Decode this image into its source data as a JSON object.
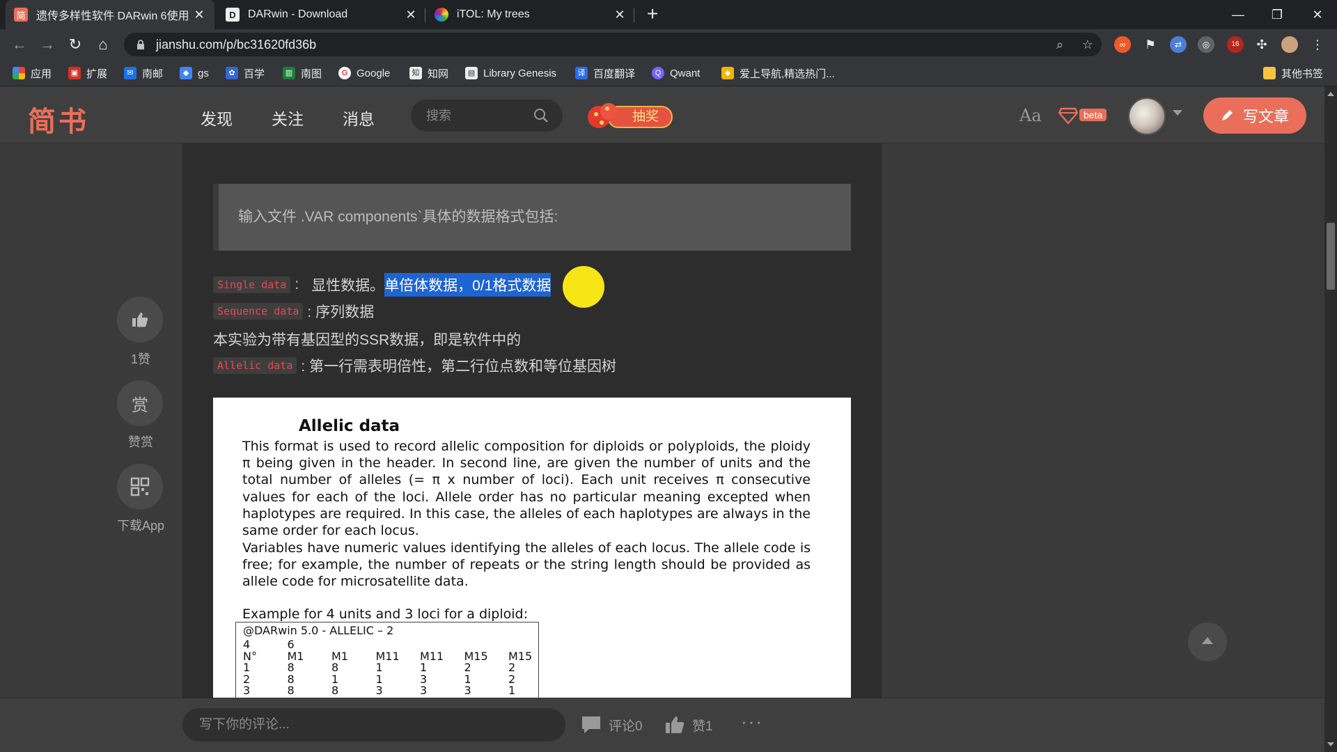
{
  "browser": {
    "tabs": [
      {
        "title": "遗传多样性软件 DARwin 6使用",
        "favicon_text": "简",
        "favicon_color": "#ea6f5a",
        "active": true
      },
      {
        "title": "DARwin - Download",
        "favicon_text": "D",
        "favicon_color": "#3d3d3d",
        "active": false
      },
      {
        "title": "iTOL: My trees",
        "favicon_text": "",
        "favicon_color": "#3a55c8",
        "active": false
      }
    ],
    "url": "jianshu.com/p/bc31620fd36b",
    "profile_badge": "16",
    "bookmarks": [
      {
        "label": "应用",
        "color": "#4285f4"
      },
      {
        "label": "扩展",
        "color": "#d93025"
      },
      {
        "label": "南邮",
        "color": "#1a73e8"
      },
      {
        "label": "gs",
        "color": "#4285f4"
      },
      {
        "label": "百学",
        "color": "#3367d6"
      },
      {
        "label": "南图",
        "color": "#188038"
      },
      {
        "label": "Google",
        "color": "#ea4335"
      },
      {
        "label": "知网",
        "color": "#5f6368"
      },
      {
        "label": "Library Genesis",
        "color": "#5f6368"
      },
      {
        "label": "百度翻译",
        "color": "#2b6de8"
      },
      {
        "label": "Qwant",
        "color": "#7b61ff"
      },
      {
        "label": "爱上导航,精选热门...",
        "color": "#f4b400"
      }
    ],
    "other_bookmarks": "其他书签"
  },
  "site": {
    "logo": "简书",
    "nav": [
      "发现",
      "关注",
      "消息"
    ],
    "search_placeholder": "搜索",
    "lottery_label": "抽奖",
    "font_button": "Aa",
    "beta_label": "beta",
    "write_button": "写文章"
  },
  "article": {
    "blockquote": "输入文件 .VAR components`具体的数据格式包括:",
    "lines": {
      "single_tag": "Single data",
      "single_sep": ":",
      "single_text": "显性数据。",
      "single_highlight": "单倍体数据，0/1格式数据",
      "sequence_tag": "Sequence data",
      "sequence_text": ": 序列数据",
      "experiment_text": "本实验为带有基因型的SSR数据，即是软件中的",
      "allelic_tag": "Allelic data",
      "allelic_text": ": 第一行需表明倍性，第二行位点数和等位基因树"
    },
    "image": {
      "title": "Allelic data",
      "para1": "This format is used to record allelic composition for diploids or polyploids, the ploidy π being given in the header. In second line, are given the number of units and the total number of alleles (= π x number of loci). Each unit receives π consecutive values for each of the loci. Allele order has no particular meaning excepted when haplotypes are required. In this case, the alleles of each haplotypes are always in the same order for each locus.",
      "para2": "Variables have numeric values identifying the alleles of each locus. The allele code is free; for example, the number of repeats or the string length should be provided as allele code for microsatellite data.",
      "example": "Example for 4 units and 3 loci for a diploid:",
      "table_header": "@DARwin 5.0 - ALLELIC – 2",
      "table_rows": [
        [
          "4",
          "6",
          "",
          "",
          "",
          "",
          ""
        ],
        [
          "N°",
          "M1",
          "M1",
          "M11",
          "M11",
          "M15",
          "M15"
        ],
        [
          "1",
          "8",
          "8",
          "1",
          "1",
          "2",
          "2"
        ],
        [
          "2",
          "8",
          "1",
          "1",
          "3",
          "1",
          "2"
        ],
        [
          "3",
          "8",
          "8",
          "3",
          "3",
          "3",
          "1"
        ]
      ]
    }
  },
  "side": {
    "like_count": "1赞",
    "reward_label": "赞赏",
    "reward_icon": "赏",
    "app_label": "下载App"
  },
  "bottom": {
    "comment_placeholder": "写下你的评论...",
    "comment_count": "评论0",
    "like_count": "赞1",
    "more": "···"
  }
}
